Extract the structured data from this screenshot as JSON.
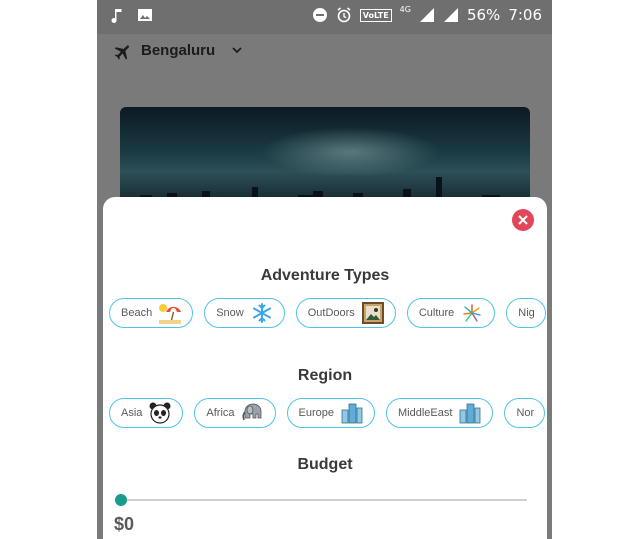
{
  "statusbar": {
    "battery": "56%",
    "time": "7:06",
    "network": "4G",
    "volte": "VoLTE"
  },
  "header": {
    "city": "Bengaluru"
  },
  "sheet": {
    "adventure_title": "Adventure Types",
    "adventure_types": [
      {
        "label": "Beach",
        "icon": "beach-umbrella-icon"
      },
      {
        "label": "Snow",
        "icon": "snowflake-icon"
      },
      {
        "label": "OutDoors",
        "icon": "picture-frame-icon"
      },
      {
        "label": "Culture",
        "icon": "fireworks-icon"
      },
      {
        "label": "Nig",
        "icon": ""
      }
    ],
    "region_title": "Region",
    "regions": [
      {
        "label": "Asia",
        "icon": "panda-icon"
      },
      {
        "label": "Africa",
        "icon": "elephant-icon"
      },
      {
        "label": "Europe",
        "icon": "buildings-icon"
      },
      {
        "label": "MiddleEast",
        "icon": "buildings-icon"
      },
      {
        "label": "Nor",
        "icon": ""
      }
    ],
    "budget_title": "Budget",
    "budget_value": "$0",
    "budget_fraction": 0
  },
  "colors": {
    "accent": "#4fc3e8",
    "close": "#e0485a",
    "slider_thumb": "#1a9c8c"
  }
}
